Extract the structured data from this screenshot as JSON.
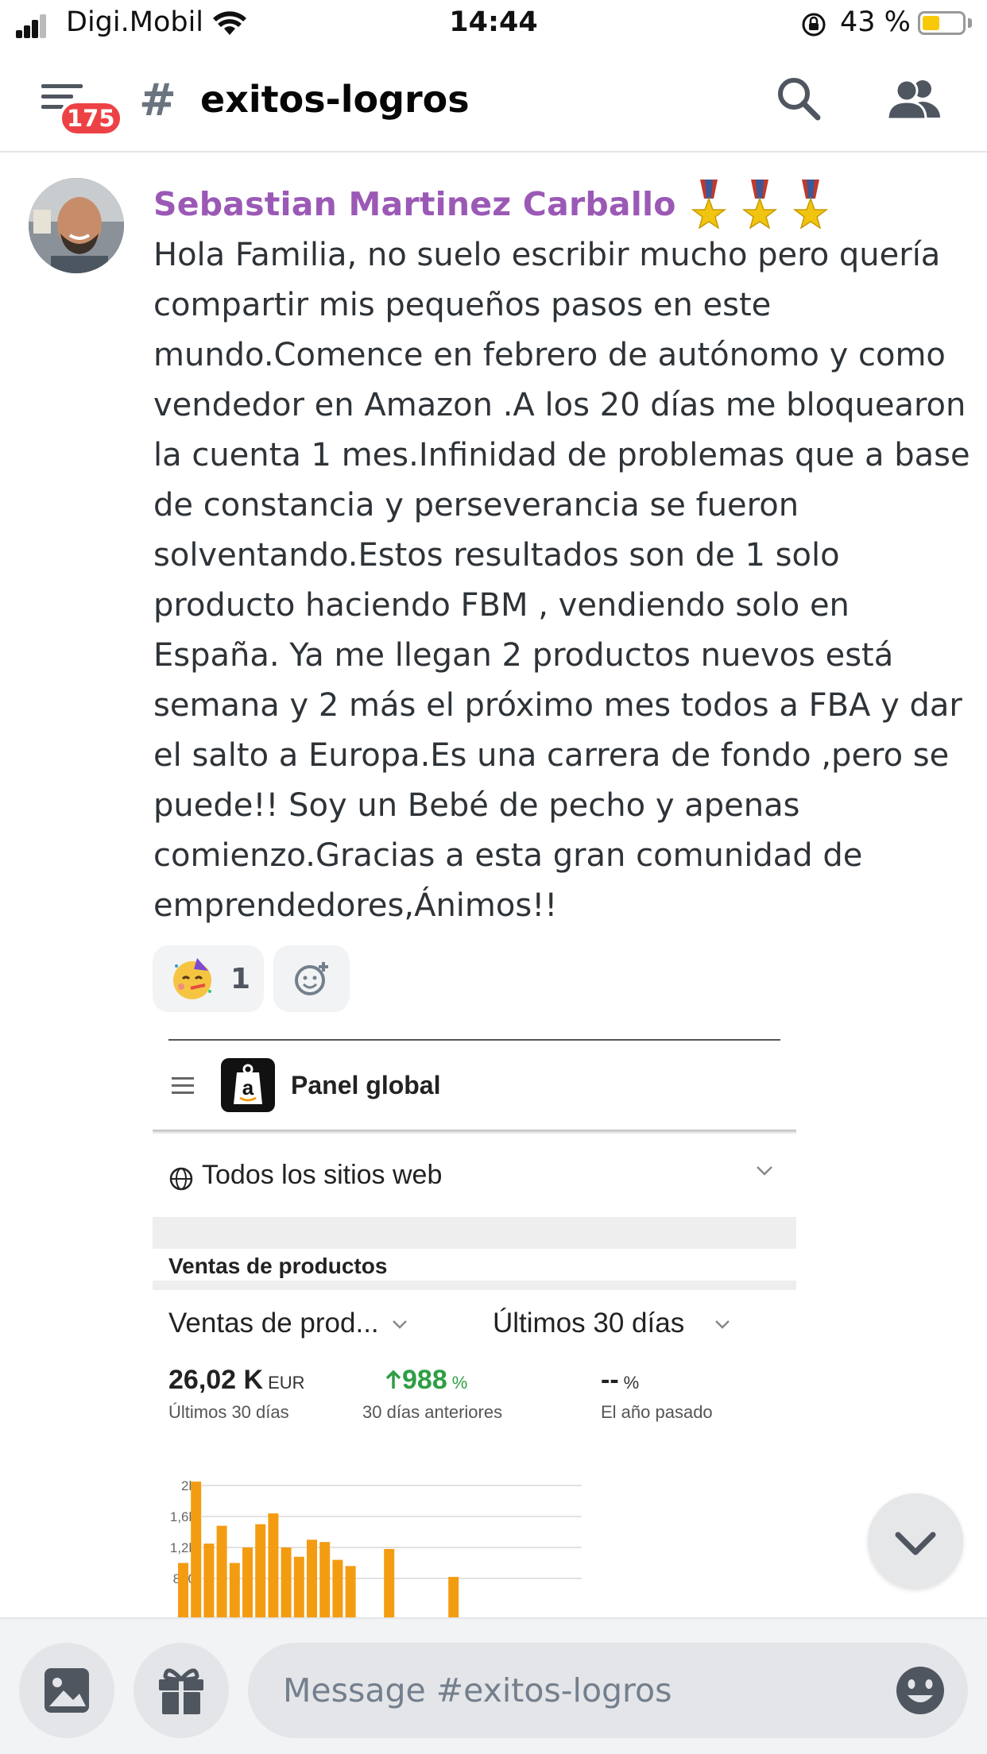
{
  "status_bar": {
    "carrier": "Digi.Mobil",
    "time": "14:44",
    "battery_text": "43 %",
    "battery_level": 0.43,
    "colors": {
      "battery_fill": "#f7c90a"
    }
  },
  "header": {
    "unread_badge": "175",
    "channel_name": "exitos-logros",
    "icons": [
      "menu-icon",
      "hash-icon",
      "search-icon",
      "members-icon"
    ]
  },
  "message": {
    "author": "Sebastian Martinez Carballo",
    "author_color": "#9b59b6",
    "badges": [
      "military-medal",
      "military-medal",
      "military-medal"
    ],
    "text": "Hola Familia, no suelo escribir mucho pero quería compartir mis pequeños pasos en este mundo.Comence en febrero de autónomo y como vendedor en Amazon .A los 20 días me bloquearon la cuenta 1 mes.Infinidad de problemas que a base de constancia y perseverancia se fueron solventando.Estos resultados son de 1 solo producto haciendo FBM , vendiendo solo en España. Ya me llegan 2 productos nuevos está semana y 2 más el próximo mes todos a FBA y dar el salto a Europa.Es una carrera de fondo ,pero se puede!! Soy un Bebé de pecho y apenas comienzo.Gracias a esta gran comunidad de emprendedores,Ánimos!!",
    "reactions": [
      {
        "emoji": "partying-face",
        "count": "1"
      }
    ],
    "add_reaction_icon": "add-reaction-icon"
  },
  "attachment": {
    "app_title": "Panel global",
    "sites_selector": "Todos los sitios web",
    "section_title": "Ventas de productos",
    "dropdown_metric": "Ventas de prod...",
    "dropdown_period": "Últimos 30 días",
    "metrics": [
      {
        "value": "26,02 K",
        "unit": "EUR",
        "label": "Últimos 30 días"
      },
      {
        "value": "988",
        "unit": "%",
        "label": "30 días anteriores",
        "trend": "up"
      },
      {
        "value": "--",
        "unit": "%",
        "label": "El año pasado"
      }
    ]
  },
  "chart_data": {
    "type": "bar",
    "y_tick_labels": [
      "2k",
      "1,6k",
      "1,2k",
      "800"
    ],
    "y_ticks": [
      2000,
      1600,
      1200,
      800
    ],
    "ylim": [
      0,
      2000
    ],
    "grid": true,
    "bar_color": "#f39c12",
    "values": [
      1000,
      2050,
      1250,
      1480,
      1000,
      1200,
      1500,
      1640,
      1200,
      1080,
      1300,
      1270,
      1040,
      960,
      0,
      0,
      1180,
      0,
      0,
      0,
      0,
      820
    ]
  },
  "composer": {
    "placeholder": "Message #exitos-logros",
    "icons": [
      "image-icon",
      "gift-icon",
      "emoji-icon"
    ]
  }
}
